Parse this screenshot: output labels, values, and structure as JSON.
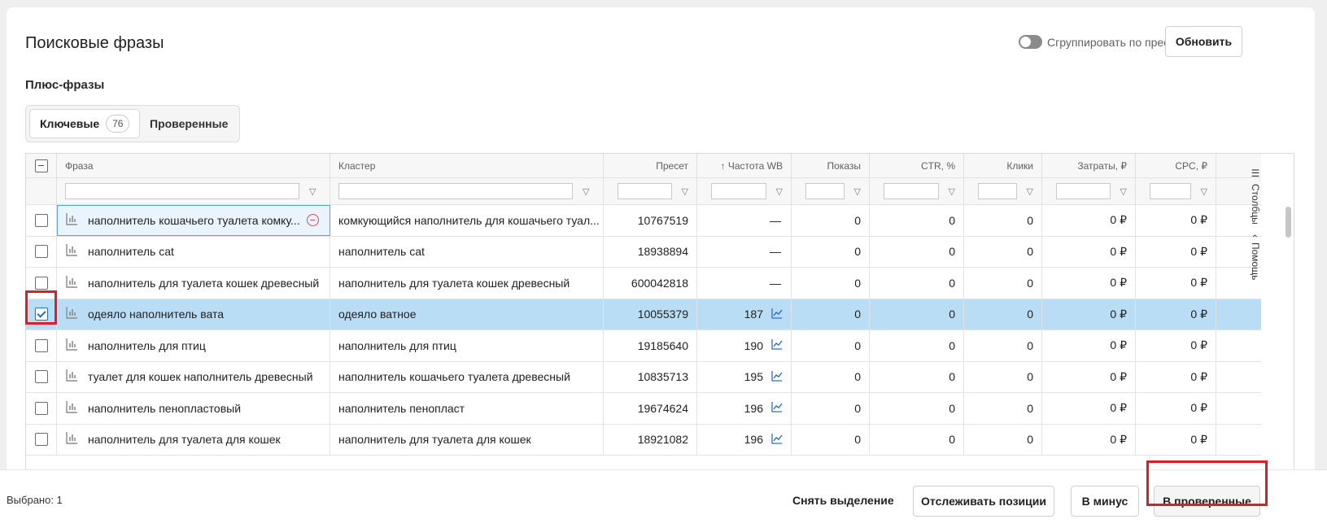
{
  "header": {
    "title": "Поисковые фразы",
    "group_toggle_label": "Сгруппировать по пресетам",
    "refresh_label": "Обновить"
  },
  "section": {
    "title": "Плюс-фразы"
  },
  "tabs": [
    {
      "label": "Ключевые",
      "count": "76",
      "active": true
    },
    {
      "label": "Проверенные",
      "active": false
    }
  ],
  "table": {
    "columns": [
      "Фраза",
      "Кластер",
      "Пресет",
      "↑ Частота WB",
      "Показы",
      "CTR, %",
      "Клики",
      "Затраты, ₽",
      "CPC, ₽"
    ],
    "rows": [
      {
        "phrase": "наполнитель кошачьего туалета комку...",
        "cluster": "комкующийся наполнитель для кошачьего туал...",
        "preset": "10767519",
        "freq": "—",
        "impressions": "0",
        "ctr": "0",
        "clicks": "0",
        "cost": "0 ₽",
        "cpc": "0 ₽",
        "checked": false,
        "focused": true,
        "trend": false
      },
      {
        "phrase": "наполнитель cat",
        "cluster": "наполнитель cat",
        "preset": "18938894",
        "freq": "—",
        "impressions": "0",
        "ctr": "0",
        "clicks": "0",
        "cost": "0 ₽",
        "cpc": "0 ₽",
        "checked": false,
        "trend": false
      },
      {
        "phrase": "наполнитель для туалета кошек древесный",
        "cluster": "наполнитель для туалета кошек древесный",
        "preset": "600042818",
        "freq": "—",
        "impressions": "0",
        "ctr": "0",
        "clicks": "0",
        "cost": "0 ₽",
        "cpc": "0 ₽",
        "checked": false,
        "trend": false
      },
      {
        "phrase": "одеяло наполнитель вата",
        "cluster": "одеяло ватное",
        "preset": "10055379",
        "freq": "187",
        "impressions": "0",
        "ctr": "0",
        "clicks": "0",
        "cost": "0 ₽",
        "cpc": "0 ₽",
        "checked": true,
        "trend": true
      },
      {
        "phrase": "наполнитель для птиц",
        "cluster": "наполнитель для птиц",
        "preset": "19185640",
        "freq": "190",
        "impressions": "0",
        "ctr": "0",
        "clicks": "0",
        "cost": "0 ₽",
        "cpc": "0 ₽",
        "checked": false,
        "trend": true
      },
      {
        "phrase": "туалет для кошек наполнитель древесный",
        "cluster": "наполнитель кошачьего туалета древесный",
        "preset": "10835713",
        "freq": "195",
        "impressions": "0",
        "ctr": "0",
        "clicks": "0",
        "cost": "0 ₽",
        "cpc": "0 ₽",
        "checked": false,
        "trend": true
      },
      {
        "phrase": "наполнитель пенопластовый",
        "cluster": "наполнитель пенопласт",
        "preset": "19674624",
        "freq": "196",
        "impressions": "0",
        "ctr": "0",
        "clicks": "0",
        "cost": "0 ₽",
        "cpc": "0 ₽",
        "checked": false,
        "trend": true
      },
      {
        "phrase": "наполнитель для туалета для кошек",
        "cluster": "наполнитель для туалета для кошек",
        "preset": "18921082",
        "freq": "196",
        "impressions": "0",
        "ctr": "0",
        "clicks": "0",
        "cost": "0 ₽",
        "cpc": "0 ₽",
        "checked": false,
        "trend": true
      }
    ]
  },
  "side_panel": {
    "columns_label": "Столбцы",
    "help_label": "Помощь"
  },
  "footer": {
    "selected_label": "Выбрано: 1",
    "clear_label": "Снять выделение",
    "track_label": "Отслеживать позиции",
    "minus_label": "В минус",
    "verified_label": "В проверенные"
  },
  "colors": {
    "selected_row": "#b9ddf5",
    "highlight": "#dc1f26",
    "accent": "#1f6fd1"
  }
}
